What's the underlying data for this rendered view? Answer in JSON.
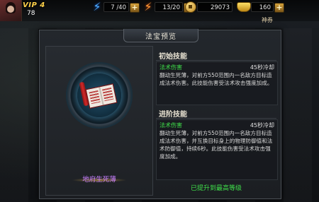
{
  "topbar": {
    "vip_label": "VIP 4",
    "level": "78",
    "stamina": "7 /40",
    "energy": "13/20",
    "coins": "29073",
    "ingots": "160",
    "ingot_label": "神券",
    "plus_symbol": "+"
  },
  "panel": {
    "title": "法宝预览",
    "item_name": "地府生死薄",
    "base_skill": {
      "heading": "初始技能",
      "type": "法术伤害",
      "cooldown": "45秒冷却",
      "description": "翻动生死薄，对前方550范围内一名敌方目标造成法术伤害。此技能伤害受法术攻击强度加成。"
    },
    "advanced_skill": {
      "heading": "进阶技能",
      "type": "法术伤害",
      "cooldown": "45秒冷却",
      "description": "翻动生死薄，对前方550范围内一名敌方目标造成法术伤害，并互换目标身上的物理防御值和法术防御值，持续6秒。此技能伤害受法术攻击强度加成。"
    },
    "max_level_text": "已提升到最高等级"
  },
  "colors": {
    "accent_green": "#3fe04a",
    "item_purple": "#c77dff",
    "vip_gold": "#ffd24a"
  },
  "icons": {
    "stamina": "blue-bolt-icon",
    "energy": "orange-bolt-icon",
    "coins": "coin-icon",
    "ingots": "gold-ingot-icon"
  }
}
